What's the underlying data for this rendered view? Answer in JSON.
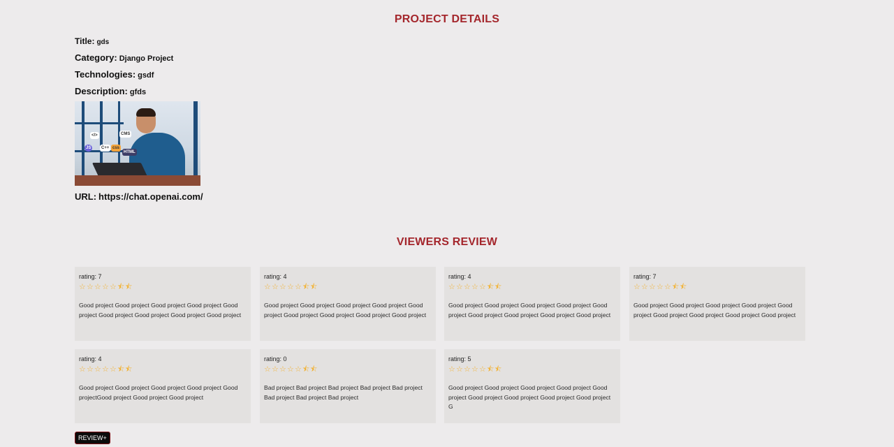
{
  "headings": {
    "project_details": "PROJECT DETAILS",
    "viewers_review": "VIEWERS REVIEW"
  },
  "project": {
    "title_label": "Title:",
    "title_value": "gds",
    "category_label": "Category:",
    "category_value": "Django Project",
    "technologies_label": "Technologies:",
    "technologies_value": "gsdf",
    "description_label": "Description:",
    "description_value": "gfds",
    "url_label": "URL:",
    "url_value": "https://chat.openai.com/",
    "image_bubbles": [
      "</>",
      "CMS",
      "JS",
      "C++",
      "css",
      "HTML"
    ]
  },
  "reviews": [
    {
      "rating_text": "rating: 7",
      "stars": [
        "☆",
        "☆",
        "☆",
        "☆",
        "☆",
        "⯪",
        "⯪"
      ],
      "comment": "Good project Good project Good project Good project Good project Good project Good project Good project Good project"
    },
    {
      "rating_text": "rating: 4",
      "stars": [
        "☆",
        "☆",
        "☆",
        "☆",
        "☆",
        "⯪",
        "⯪"
      ],
      "comment": "Good project Good project Good project Good project Good project Good project Good project Good project Good project"
    },
    {
      "rating_text": "rating: 4",
      "stars": [
        "☆",
        "☆",
        "☆",
        "☆",
        "☆",
        "⯪",
        "⯪"
      ],
      "comment": "Good project Good project Good project Good project Good project Good project Good project Good project Good project"
    },
    {
      "rating_text": "rating: 7",
      "stars": [
        "☆",
        "☆",
        "☆",
        "☆",
        "☆",
        "⯪",
        "⯪"
      ],
      "comment": "Good project Good project Good project Good project Good project Good project Good project Good project Good project"
    },
    {
      "rating_text": "rating: 4",
      "stars": [
        "☆",
        "☆",
        "☆",
        "☆",
        "☆",
        "⯪",
        "⯪"
      ],
      "comment": "Good project Good project Good project Good project Good projectGood project Good project Good project"
    },
    {
      "rating_text": "rating: 0",
      "stars": [
        "☆",
        "☆",
        "☆",
        "☆",
        "☆",
        "⯪",
        "⯪"
      ],
      "comment": "Bad project Bad project Bad project Bad project Bad project Bad project Bad project Bad project"
    },
    {
      "rating_text": "rating: 5",
      "stars": [
        "☆",
        "☆",
        "☆",
        "☆",
        "☆",
        "⯪",
        "⯪"
      ],
      "comment": "Good project Good project Good project Good project Good project Good project Good project Good project Good project G"
    }
  ],
  "review_button_label": "REVIEW+",
  "colors": {
    "accent_red": "#a4262c",
    "star": "#f2b233",
    "card_bg": "#e3e1e0",
    "page_bg": "#edebec"
  }
}
